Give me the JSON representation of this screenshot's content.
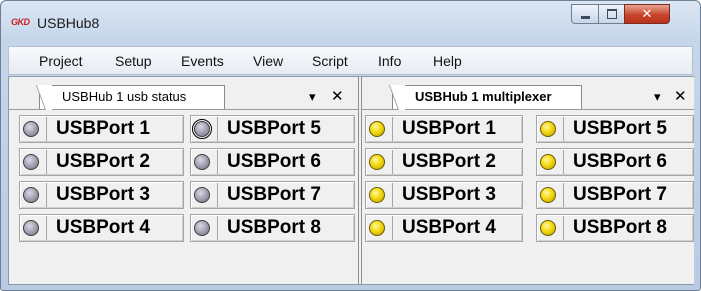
{
  "window": {
    "logo_text": "GKD",
    "title": "USBHub8",
    "controls": {
      "minimize": "minimize",
      "maximize": "maximize",
      "close": "✕"
    }
  },
  "menu": [
    "Project",
    "Setup",
    "Events",
    "View",
    "Script",
    "Info",
    "Help"
  ],
  "panels": [
    {
      "tab_label": "USBHub 1 usb status",
      "tab_dropdown": "▾",
      "tab_close": "✕",
      "ports": [
        {
          "label": "USBPort 1",
          "state": "off"
        },
        {
          "label": "USBPort 2",
          "state": "off"
        },
        {
          "label": "USBPort 3",
          "state": "off"
        },
        {
          "label": "USBPort 4",
          "state": "off"
        },
        {
          "label": "USBPort 5",
          "state": "off"
        },
        {
          "label": "USBPort 6",
          "state": "off"
        },
        {
          "label": "USBPort 7",
          "state": "off"
        },
        {
          "label": "USBPort 8",
          "state": "off"
        }
      ]
    },
    {
      "tab_label": "USBHub 1 multiplexer",
      "tab_dropdown": "▾",
      "tab_close": "✕",
      "ports": [
        {
          "label": "USBPort 1",
          "state": "on"
        },
        {
          "label": "USBPort 2",
          "state": "on"
        },
        {
          "label": "USBPort 3",
          "state": "on"
        },
        {
          "label": "USBPort 4",
          "state": "on"
        },
        {
          "label": "USBPort 5",
          "state": "on"
        },
        {
          "label": "USBPort 6",
          "state": "on"
        },
        {
          "label": "USBPort 7",
          "state": "on"
        },
        {
          "label": "USBPort 8",
          "state": "on"
        }
      ]
    }
  ],
  "colors": {
    "led_off": "#9c9cad",
    "led_on": "#f2d90d",
    "close_button": "#c8452c"
  }
}
